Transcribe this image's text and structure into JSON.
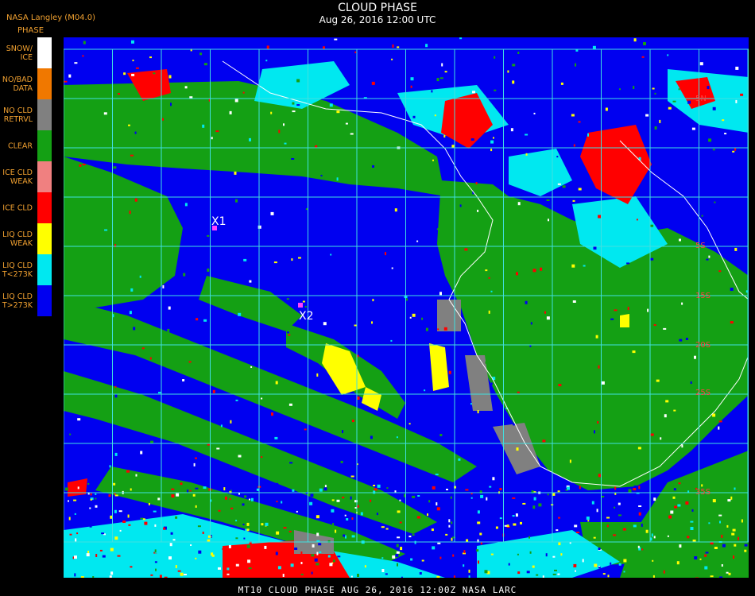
{
  "header": {
    "source": "NASA Langley (M04.0)",
    "title": "CLOUD PHASE",
    "subtitle": "Aug 26, 2016 12:00 UTC"
  },
  "legend": {
    "heading": "PHASE",
    "items": [
      {
        "label": "SNOW/\nICE",
        "color": "#ffffff"
      },
      {
        "label": "NO/BAD\nDATA",
        "color": "#f07800"
      },
      {
        "label": "NO CLD\nRETRVL",
        "color": "#808080"
      },
      {
        "label": "CLEAR",
        "color": "#14a014"
      },
      {
        "label": "ICE CLD\nWEAK",
        "color": "#f08080"
      },
      {
        "label": "ICE CLD",
        "color": "#ff0000"
      },
      {
        "label": "LIQ CLD\nWEAK",
        "color": "#ffff00"
      },
      {
        "label": "LIQ CLD\nT<273K",
        "color": "#00e8f0"
      },
      {
        "label": "LIQ CLD\nT>273K",
        "color": "#0000f0"
      }
    ]
  },
  "markers": [
    {
      "label": "X1"
    },
    {
      "label": "X2"
    }
  ],
  "grid_labels": [
    "5N",
    "5S",
    "15S",
    "20S",
    "25S",
    "35S"
  ],
  "footer": "MT10   CLOUD PHASE   AUG 26, 2016 12:00Z   NASA LARC"
}
